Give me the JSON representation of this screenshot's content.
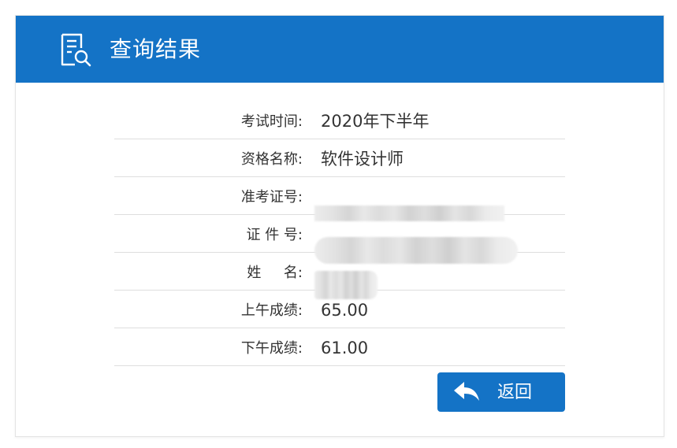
{
  "header": {
    "title": "查询结果",
    "icon": "document-search-icon",
    "background_color": "#1473c6"
  },
  "result_rows": [
    {
      "label": "考试时间:",
      "value": "2020年下半年",
      "redacted": false
    },
    {
      "label": "资格名称:",
      "value": "软件设计师",
      "redacted": false
    },
    {
      "label": "准考证号:",
      "value": "",
      "redacted": true
    },
    {
      "label": "证 件 号:",
      "value": "",
      "redacted": true
    },
    {
      "label": "姓     名:",
      "value": "",
      "redacted": true
    },
    {
      "label": "上午成绩:",
      "value": "65.00",
      "redacted": false
    },
    {
      "label": "下午成绩:",
      "value": "61.00",
      "redacted": false
    }
  ],
  "actions": {
    "back_label": "返回",
    "back_icon": "reply-arrow-icon"
  }
}
